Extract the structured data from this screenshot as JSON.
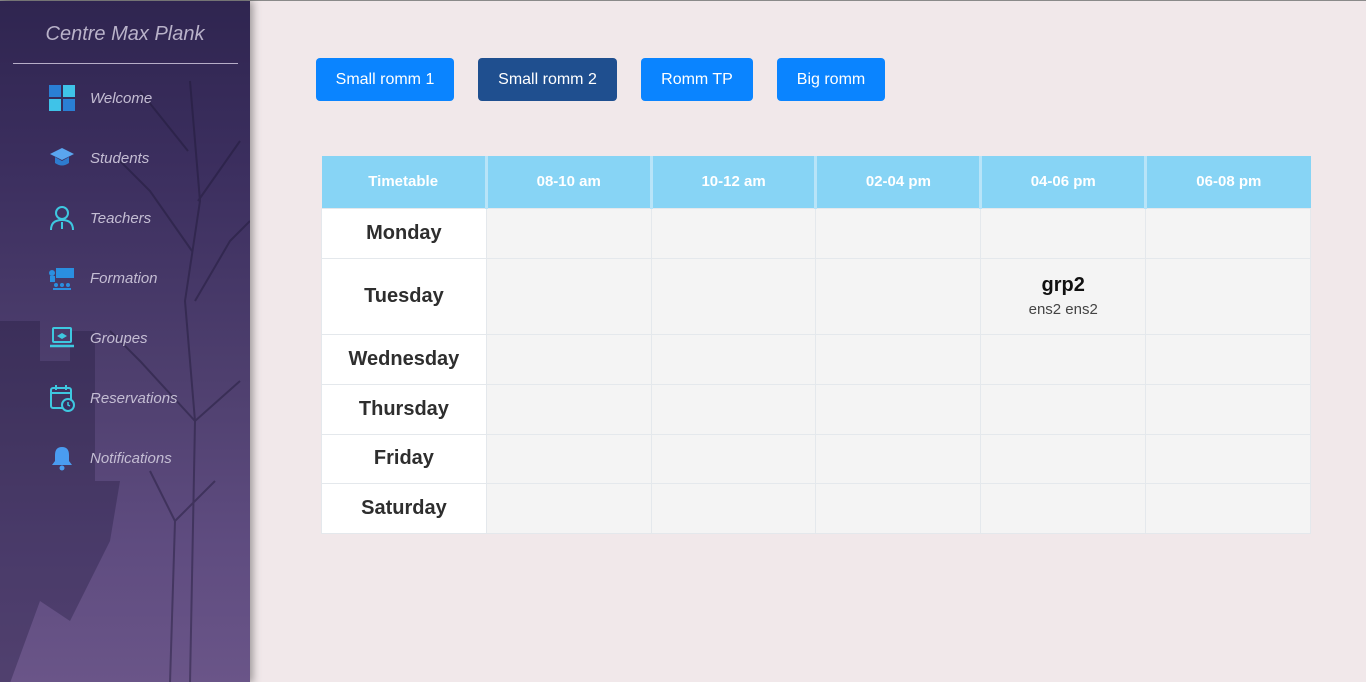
{
  "sidebar": {
    "brand": "Centre Max Plank",
    "items": [
      {
        "label": "Welcome",
        "icon": "dashboard-grid-icon"
      },
      {
        "label": "Students",
        "icon": "graduation-cap-icon"
      },
      {
        "label": "Teachers",
        "icon": "teacher-icon"
      },
      {
        "label": "Formation",
        "icon": "classroom-icon"
      },
      {
        "label": "Groupes",
        "icon": "laptop-group-icon"
      },
      {
        "label": "Reservations",
        "icon": "calendar-clock-icon"
      },
      {
        "label": "Notifications",
        "icon": "bell-icon"
      }
    ]
  },
  "rooms": {
    "buttons": [
      {
        "label": "Small romm 1",
        "active": false
      },
      {
        "label": "Small romm 2",
        "active": true
      },
      {
        "label": "Romm TP",
        "active": false
      },
      {
        "label": "Big romm",
        "active": false
      }
    ]
  },
  "timetable": {
    "headers": [
      "Timetable",
      "08-10 am",
      "10-12 am",
      "02-04 pm",
      "04-06 pm",
      "06-08 pm"
    ],
    "days": [
      "Monday",
      "Tuesday",
      "Wednesday",
      "Thursday",
      "Friday",
      "Saturday"
    ],
    "entry": {
      "day": "Tuesday",
      "slot": "04-06 pm",
      "group": "grp2",
      "teachers": "ens2 ens2"
    }
  },
  "colors": {
    "primary_button": "#0a84ff",
    "active_button": "#1f4f8f",
    "table_header": "#87d4f5",
    "page_background": "#f1e8ea",
    "sidebar": "#3c2f5f"
  }
}
